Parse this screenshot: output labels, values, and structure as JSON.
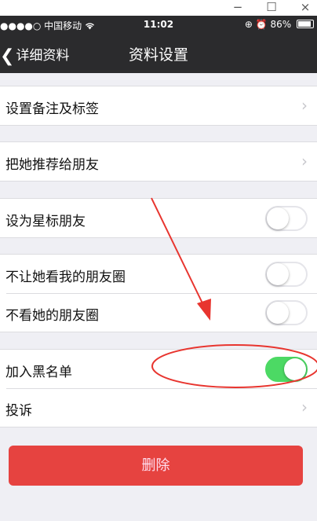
{
  "window": {
    "minimize": "−",
    "maximize": "☐",
    "close": "×"
  },
  "status_bar": {
    "carrier": "●●●●○ 中国移动",
    "wifi_icon": "wifi-icon",
    "time": "11:02",
    "battery": "86%"
  },
  "nav": {
    "back_label": "详细资料",
    "title": "资料设置"
  },
  "groups": [
    {
      "rows": [
        {
          "label": "设置备注及标签",
          "type": "arrow"
        }
      ]
    },
    {
      "rows": [
        {
          "label": "把她推荐给朋友",
          "type": "arrow"
        }
      ]
    },
    {
      "rows": [
        {
          "label": "设为星标朋友",
          "type": "toggle",
          "on": false
        }
      ]
    },
    {
      "rows": [
        {
          "label": "不让她看我的朋友圈",
          "type": "toggle",
          "on": false
        },
        {
          "label": "不看她的朋友圈",
          "type": "toggle",
          "on": false
        }
      ]
    },
    {
      "rows": [
        {
          "label": "加入黑名单",
          "type": "toggle",
          "on": true
        },
        {
          "label": "投诉",
          "type": "arrow"
        }
      ]
    }
  ],
  "delete_button": "删除",
  "colors": {
    "toggle_on": "#4cd964",
    "delete": "#e64340",
    "annotation": "#e8352f",
    "bar": "#2b2b2d"
  }
}
